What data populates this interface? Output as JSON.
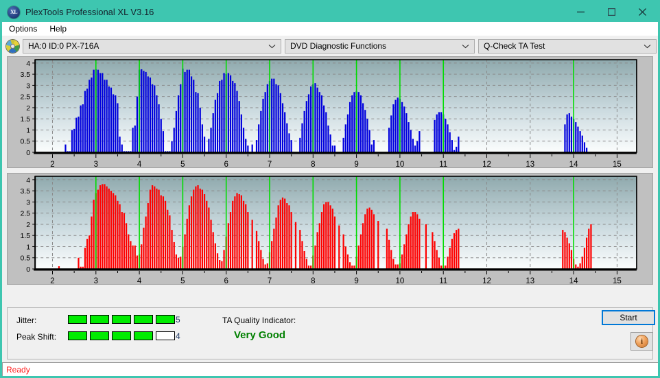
{
  "window": {
    "title": "PlexTools Professional XL V3.16",
    "app_icon": "xl-logo-icon",
    "minimize_label": "minimize-icon",
    "maximize_label": "maximize-icon",
    "close_label": "close-icon"
  },
  "menu": {
    "items": [
      {
        "label": "Options"
      },
      {
        "label": "Help"
      }
    ]
  },
  "toolbar": {
    "drive_icon": "optical-disc-icon",
    "drive_value": "HA:0 ID:0  PX-716A",
    "function_value": "DVD Diagnostic Functions",
    "test_value": "Q-Check TA Test",
    "caret_icon": "chevron-down-icon"
  },
  "results": {
    "jitter_label": "Jitter:",
    "jitter_value": "5",
    "jitter_filled": 5,
    "jitter_total": 5,
    "peak_shift_label": "Peak Shift:",
    "peak_shift_value": "4",
    "peak_shift_filled": 4,
    "peak_shift_total": 5,
    "quality_title": "TA Quality Indicator:",
    "quality_value": "Very Good",
    "quality_color": "#008000",
    "meter_on_color": "#00ec00",
    "start_label": "Start",
    "info_icon": "info-icon",
    "info_glyph": "i"
  },
  "statusbar": {
    "text": "Ready"
  },
  "chart_data": [
    {
      "type": "bar",
      "title": "Jitter distribution (blue)",
      "series_name": "Jitter",
      "color": "#0000dd",
      "xlabel": "",
      "ylabel": "",
      "xlim": [
        1.6,
        15.45
      ],
      "ylim": [
        0,
        4.15
      ],
      "xticks": [
        2,
        3,
        4,
        5,
        6,
        7,
        8,
        9,
        10,
        11,
        12,
        13,
        14,
        15
      ],
      "yticks": [
        0,
        0.5,
        1,
        1.5,
        2,
        2.5,
        3,
        3.5,
        4
      ],
      "grid": true,
      "grid_style": "dashed",
      "markers": [
        3,
        4,
        5,
        6,
        7,
        8,
        9,
        10,
        11,
        14
      ],
      "marker_color": "#00dd00",
      "bar_width": 0.035,
      "x": [
        2.3,
        2.35,
        2.4,
        2.45,
        2.5,
        2.55,
        2.6,
        2.65,
        2.7,
        2.75,
        2.8,
        2.85,
        2.9,
        2.95,
        3.0,
        3.05,
        3.1,
        3.15,
        3.2,
        3.25,
        3.3,
        3.35,
        3.4,
        3.45,
        3.5,
        3.55,
        3.6,
        3.65,
        3.7,
        3.75,
        3.8,
        3.85,
        3.9,
        3.95,
        4.0,
        4.05,
        4.1,
        4.15,
        4.2,
        4.25,
        4.3,
        4.35,
        4.4,
        4.45,
        4.5,
        4.55,
        4.6,
        4.65,
        4.7,
        4.75,
        4.8,
        4.85,
        4.9,
        4.95,
        5.0,
        5.05,
        5.1,
        5.15,
        5.2,
        5.25,
        5.3,
        5.35,
        5.4,
        5.45,
        5.5,
        5.6,
        5.65,
        5.7,
        5.75,
        5.8,
        5.85,
        5.9,
        5.95,
        6.0,
        6.05,
        6.1,
        6.15,
        6.2,
        6.25,
        6.3,
        6.35,
        6.4,
        6.45,
        6.5,
        6.6,
        6.7,
        6.75,
        6.8,
        6.85,
        6.9,
        6.95,
        7.0,
        7.05,
        7.1,
        7.15,
        7.2,
        7.25,
        7.3,
        7.35,
        7.4,
        7.45,
        7.5,
        7.7,
        7.75,
        7.8,
        7.85,
        7.9,
        7.95,
        8.0,
        8.05,
        8.1,
        8.15,
        8.2,
        8.25,
        8.3,
        8.35,
        8.4,
        8.45,
        8.5,
        8.7,
        8.75,
        8.8,
        8.85,
        8.9,
        8.95,
        9.0,
        9.05,
        9.1,
        9.15,
        9.2,
        9.25,
        9.3,
        9.35,
        9.4,
        9.75,
        9.8,
        9.85,
        9.9,
        9.95,
        10.0,
        10.05,
        10.1,
        10.15,
        10.2,
        10.25,
        10.3,
        10.35,
        10.4,
        10.45,
        10.8,
        10.85,
        10.9,
        10.95,
        11.0,
        11.05,
        11.1,
        11.15,
        11.2,
        11.25,
        11.3,
        11.35,
        13.8,
        13.85,
        13.9,
        13.95,
        14.0,
        14.05,
        14.1,
        14.15,
        14.2,
        14.25,
        14.3,
        14.35,
        14.4,
        14.45
      ],
      "values": [
        0.35,
        0.05,
        0.05,
        1.0,
        1.05,
        1.55,
        1.6,
        2.1,
        2.15,
        2.75,
        2.85,
        3.25,
        3.35,
        3.7,
        3.72,
        3.7,
        3.55,
        3.55,
        3.25,
        3.25,
        2.95,
        2.9,
        2.6,
        2.55,
        2.2,
        0.7,
        0.35,
        0.05,
        0.05,
        0.05,
        0.05,
        1.1,
        1.2,
        2.5,
        3.7,
        3.72,
        3.65,
        3.6,
        3.4,
        3.35,
        3.05,
        3.0,
        2.55,
        2.15,
        1.5,
        0.95,
        0.05,
        0.05,
        0.05,
        0.5,
        1.1,
        1.85,
        2.55,
        3.05,
        3.75,
        3.6,
        3.7,
        3.7,
        3.4,
        3.25,
        2.7,
        2.65,
        2.0,
        1.25,
        0.7,
        0.6,
        1.1,
        1.75,
        2.35,
        2.65,
        3.2,
        3.25,
        3.55,
        3.5,
        3.55,
        3.45,
        3.2,
        3.1,
        2.75,
        2.3,
        1.7,
        1.1,
        0.6,
        0.3,
        0.35,
        0.55,
        1.25,
        1.85,
        2.4,
        2.7,
        3.05,
        3.2,
        3.3,
        3.3,
        3.05,
        3.0,
        2.65,
        2.2,
        1.8,
        1.3,
        0.85,
        0.55,
        0.65,
        1.3,
        1.85,
        2.3,
        2.6,
        2.95,
        3.05,
        3.1,
        2.9,
        2.7,
        2.55,
        2.1,
        1.8,
        1.2,
        0.8,
        0.3,
        0.3,
        0.65,
        1.25,
        1.7,
        2.25,
        2.55,
        2.7,
        2.75,
        2.7,
        2.55,
        2.2,
        1.9,
        1.5,
        1.0,
        0.35,
        0.55,
        1.1,
        1.65,
        2.15,
        2.35,
        2.45,
        2.4,
        2.25,
        2.05,
        1.75,
        1.35,
        1.0,
        0.6,
        0.3,
        0.5,
        0.95,
        1.45,
        1.7,
        1.8,
        1.8,
        1.7,
        1.5,
        1.25,
        0.9,
        0.55,
        0.1,
        0.25,
        0.7,
        1.25,
        1.7,
        1.75,
        1.6,
        1.5,
        1.35,
        1.15,
        0.95,
        0.75,
        0.45,
        0.2
      ]
    },
    {
      "type": "bar",
      "title": "Peak shift distribution (red)",
      "series_name": "Peak Shift",
      "color": "#ff0000",
      "xlabel": "",
      "ylabel": "",
      "xlim": [
        1.6,
        15.45
      ],
      "ylim": [
        0,
        4.15
      ],
      "xticks": [
        2,
        3,
        4,
        5,
        6,
        7,
        8,
        9,
        10,
        11,
        12,
        13,
        14,
        15
      ],
      "yticks": [
        0,
        0.5,
        1,
        1.5,
        2,
        2.5,
        3,
        3.5,
        4
      ],
      "grid": true,
      "grid_style": "dashed",
      "markers": [
        3,
        4,
        5,
        6,
        7,
        8,
        9,
        10,
        11,
        14
      ],
      "marker_color": "#00dd00",
      "bar_width": 0.035,
      "x": [
        2.15,
        2.6,
        2.65,
        2.7,
        2.75,
        2.8,
        2.85,
        2.9,
        2.95,
        3.0,
        3.05,
        3.1,
        3.15,
        3.2,
        3.25,
        3.3,
        3.35,
        3.4,
        3.45,
        3.5,
        3.55,
        3.6,
        3.65,
        3.7,
        3.75,
        3.8,
        3.85,
        3.9,
        3.95,
        4.0,
        4.05,
        4.1,
        4.15,
        4.2,
        4.25,
        4.3,
        4.35,
        4.4,
        4.45,
        4.5,
        4.55,
        4.6,
        4.65,
        4.7,
        4.75,
        4.8,
        4.85,
        4.9,
        4.95,
        5.0,
        5.05,
        5.1,
        5.15,
        5.2,
        5.25,
        5.3,
        5.35,
        5.4,
        5.45,
        5.5,
        5.55,
        5.6,
        5.65,
        5.7,
        5.75,
        5.8,
        5.85,
        5.9,
        5.95,
        6.0,
        6.05,
        6.1,
        6.15,
        6.2,
        6.25,
        6.3,
        6.35,
        6.4,
        6.45,
        6.5,
        6.6,
        6.7,
        6.75,
        6.8,
        6.85,
        6.9,
        6.95,
        7.0,
        7.05,
        7.1,
        7.15,
        7.2,
        7.25,
        7.3,
        7.35,
        7.4,
        7.45,
        7.5,
        7.6,
        7.7,
        7.75,
        7.8,
        7.85,
        7.9,
        7.95,
        8.0,
        8.05,
        8.1,
        8.15,
        8.2,
        8.25,
        8.3,
        8.35,
        8.4,
        8.45,
        8.5,
        8.6,
        8.7,
        8.75,
        8.8,
        8.85,
        8.9,
        8.95,
        9.0,
        9.05,
        9.1,
        9.15,
        9.2,
        9.25,
        9.3,
        9.35,
        9.4,
        9.5,
        9.7,
        9.75,
        9.8,
        9.85,
        9.9,
        9.95,
        10.0,
        10.05,
        10.1,
        10.15,
        10.2,
        10.25,
        10.3,
        10.35,
        10.4,
        10.45,
        10.6,
        10.75,
        10.8,
        10.85,
        10.9,
        10.95,
        11.0,
        11.05,
        11.1,
        11.15,
        11.2,
        11.25,
        11.3,
        11.35,
        13.75,
        13.8,
        13.85,
        13.9,
        13.95,
        14.0,
        14.05,
        14.1,
        14.15,
        14.2,
        14.25,
        14.3,
        14.35,
        14.4
      ],
      "values": [
        0.12,
        0.5,
        0.1,
        0.1,
        0.95,
        1.35,
        1.5,
        2.35,
        3.1,
        3.4,
        3.55,
        3.75,
        3.8,
        3.8,
        3.7,
        3.6,
        3.5,
        3.4,
        3.3,
        3.05,
        2.9,
        2.55,
        2.5,
        2.05,
        1.55,
        1.25,
        1.05,
        1.05,
        0.6,
        0.65,
        1.1,
        1.85,
        2.35,
        2.95,
        3.55,
        3.75,
        3.7,
        3.6,
        3.55,
        3.3,
        3.25,
        3.05,
        2.65,
        2.4,
        1.75,
        1.2,
        0.65,
        0.5,
        0.55,
        1.0,
        1.55,
        2.25,
        2.85,
        3.25,
        3.55,
        3.7,
        3.75,
        3.6,
        3.55,
        3.35,
        3.05,
        2.75,
        2.2,
        1.65,
        1.15,
        0.7,
        0.4,
        0.35,
        0.85,
        1.45,
        2.05,
        2.55,
        3.05,
        3.25,
        3.4,
        3.35,
        3.3,
        3.05,
        2.9,
        2.55,
        2.2,
        1.7,
        1.25,
        0.85,
        0.45,
        0.2,
        0.25,
        0.75,
        1.25,
        1.8,
        2.3,
        2.85,
        3.1,
        3.2,
        3.15,
        2.95,
        2.85,
        2.55,
        2.1,
        1.75,
        1.25,
        0.8,
        0.45,
        0.15,
        0.15,
        0.6,
        1.05,
        1.65,
        2.05,
        2.55,
        2.9,
        3.0,
        3.0,
        2.85,
        2.7,
        2.35,
        1.95,
        1.55,
        1.0,
        0.65,
        0.3,
        0.15,
        0.15,
        0.55,
        1.05,
        1.55,
        2.05,
        2.45,
        2.7,
        2.75,
        2.65,
        2.45,
        2.15,
        1.8,
        1.3,
        0.85,
        0.45,
        0.2,
        0.2,
        0.25,
        0.65,
        1.1,
        1.55,
        2.0,
        2.35,
        2.55,
        2.55,
        2.45,
        2.25,
        2.0,
        1.65,
        1.25,
        0.85,
        0.5,
        0.15,
        0.15,
        0.15,
        0.55,
        0.95,
        1.35,
        1.6,
        1.75,
        1.8,
        1.75,
        1.65,
        1.4,
        1.15,
        0.85,
        0.45,
        0.2,
        0.1,
        0.25,
        0.55,
        0.95,
        1.4,
        1.8,
        2.0,
        1.95,
        1.8,
        1.65,
        1.45,
        1.2,
        0.9,
        0.55,
        0.25
      ]
    }
  ]
}
